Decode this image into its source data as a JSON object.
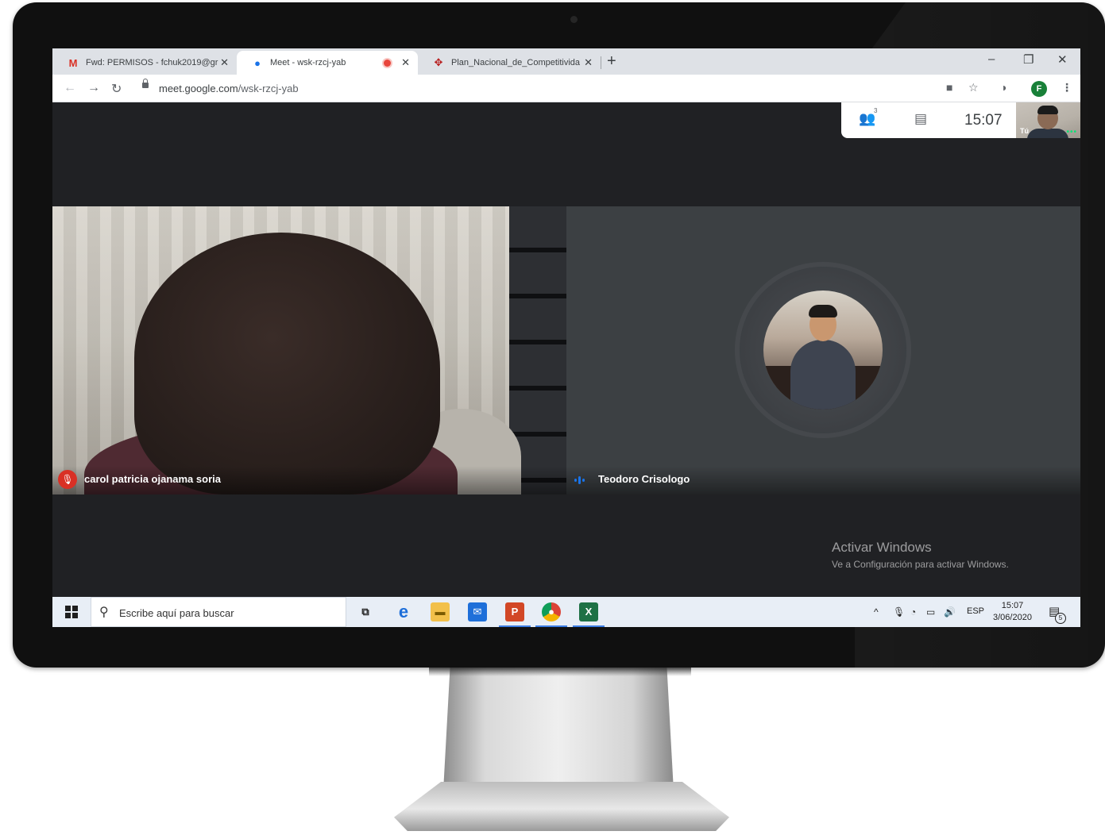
{
  "browser": {
    "tabs": [
      {
        "icon": "gmail-icon",
        "title": "Fwd: PERMISOS - fchuk2019@gr",
        "close": "✕"
      },
      {
        "icon": "meet-icon",
        "title": "Meet - wsk-rzcj-yab",
        "close": "✕",
        "recording": true
      },
      {
        "icon": "peru-shield-icon",
        "title": "Plan_Nacional_de_Competitivida",
        "close": "✕"
      }
    ],
    "new_tab": "+",
    "window_controls": {
      "minimize": "–",
      "restore": "❐",
      "close": "✕"
    },
    "url": {
      "host": "meet.google.com",
      "path": "/wsk-rzcj-yab"
    },
    "profile_initial": "F"
  },
  "meet": {
    "participants_count": "3",
    "clock": "15:07",
    "self_view_label": "Tú",
    "participants": [
      {
        "name": "carol patricia ojanama soria",
        "muted": true
      },
      {
        "name": "Teodoro Crisologo",
        "speaking": true
      }
    ]
  },
  "watermark": {
    "title": "Activar Windows",
    "subtitle": "Ve a Configuración para activar Windows."
  },
  "taskbar": {
    "search_placeholder": "Escribe aquí para buscar",
    "language": "ESP",
    "time": "15:07",
    "date": "3/06/2020",
    "notification_count": "5"
  },
  "colors": {
    "meet_background": "#202124",
    "mute_red": "#d93025",
    "speaking_blue": "#1a73e8",
    "profile_green": "#188038"
  }
}
